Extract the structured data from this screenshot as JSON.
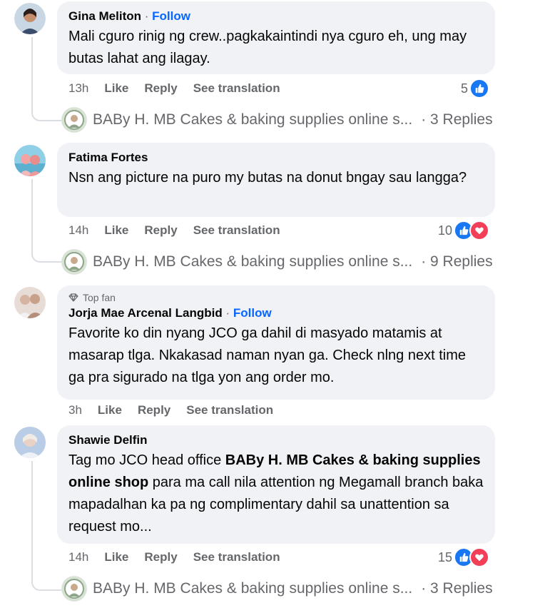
{
  "comments": [
    {
      "name": "Gina Meliton",
      "follow": "Follow",
      "text": "Mali cguro rinig ng crew..pagkakaintindi nya cguro eh, ung may butas lahat ang ilagay.",
      "time": "13h",
      "like": "Like",
      "reply": "Reply",
      "translate": "See translation",
      "reaction_count": "5",
      "reply_author": "BABy H. MB Cakes & baking supplies online s...",
      "reply_count": "· 3 Replies"
    },
    {
      "name": "Fatima Fortes",
      "text": "Nsn ang picture na puro my butas na donut bngay sau langga?",
      "time": "14h",
      "like": "Like",
      "reply": "Reply",
      "translate": "See translation",
      "reaction_count": "10",
      "reply_author": "BABy H. MB Cakes & baking supplies online s...",
      "reply_count": "· 9 Replies"
    },
    {
      "badge": "Top fan",
      "name": "Jorja Mae Arcenal Langbid",
      "follow": "Follow",
      "text": "Favorite ko din nyang JCO ga dahil di masyado matamis at masarap tlga. Nkakasad naman nyan ga. Check nlng next time ga pra sigurado na tlga yon ang order mo.",
      "time": "3h",
      "like": "Like",
      "reply": "Reply",
      "translate": "See translation"
    },
    {
      "name": "Shawie Delfin",
      "text_pre": "Tag mo JCO head office ",
      "text_bold": "BABy H. MB Cakes & baking supplies online shop",
      "text_post": " para ma call nila attention ng Megamall branch baka mapadalhan ka pa ng complimentary dahil sa unattention sa request mo...",
      "time": "14h",
      "like": "Like",
      "reply": "Reply",
      "translate": "See translation",
      "reaction_count": "15",
      "reply_author": "BABy H. MB Cakes & baking supplies online s...",
      "reply_count": "· 3 Replies"
    }
  ],
  "colors": {
    "link": "#0866ff",
    "like": "#1877f2",
    "love": "#f33e58",
    "bubble": "#f0f2f5",
    "meta": "#65676b"
  }
}
